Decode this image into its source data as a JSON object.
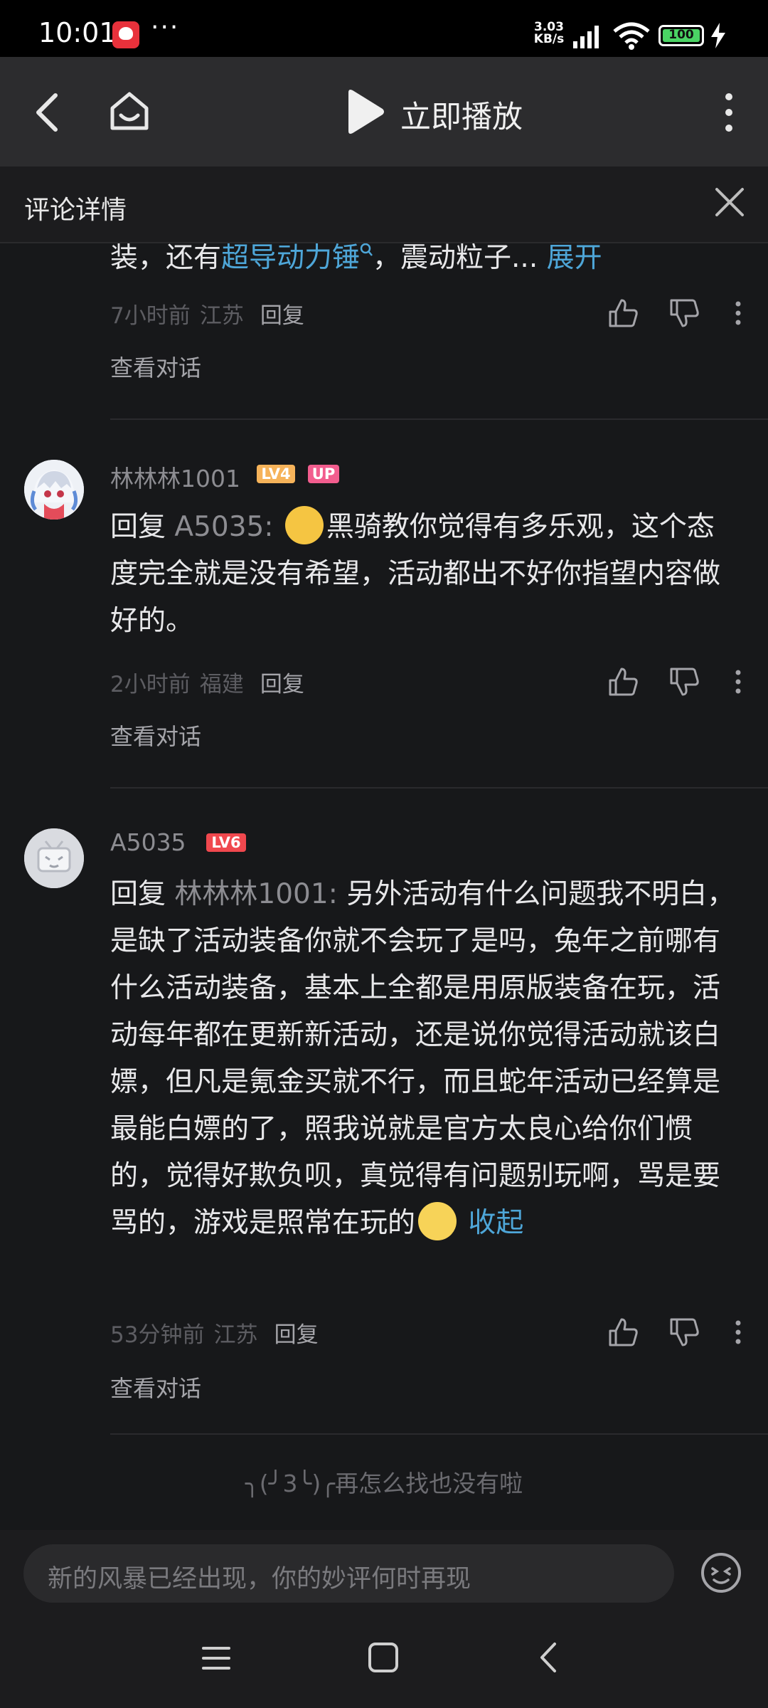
{
  "status_bar": {
    "time": "10:01",
    "dots": "···",
    "speed_value": "3.03",
    "speed_unit": "KB/s",
    "battery": "100"
  },
  "app_bar": {
    "title": "立即播放"
  },
  "panel": {
    "title": "评论详情"
  },
  "comments": [
    {
      "text_prefix": "装，还有",
      "link": "超导动力锤",
      "text_suffix": "，震动粒子...",
      "expand": "展开",
      "time": "7小时前",
      "location": "江苏",
      "reply": "回复",
      "view_conversation": "查看对话"
    },
    {
      "username": "林林林1001",
      "level": "LV4",
      "up_badge": "UP",
      "reply_prefix": "回复",
      "mention": "A5035",
      "colon": ":",
      "text": "黑骑教你觉得有多乐观，这个态度完全就是没有希望，活动都出不好你指望内容做好的。",
      "time": "2小时前",
      "location": "福建",
      "reply": "回复",
      "view_conversation": "查看对话"
    },
    {
      "username": "A5035",
      "level": "LV6",
      "reply_prefix": "回复",
      "mention": "林林林1001",
      "colon": ":",
      "text": "另外活动有什么问题我不明白，是缺了活动装备你就不会玩了是吗，兔年之前哪有什么活动装备，基本上全都是用原版装备在玩，活动每年都在更新新活动，还是说你觉得活动就该白嫖，但凡是氪金买就不行，而且蛇年活动已经算是最能白嫖的了，照我说就是官方太良心给你们惯的，觉得好欺负呗，真觉得有问题别玩啊，骂是要骂的，游戏是照常在玩的",
      "collapse": "收起",
      "time": "53分钟前",
      "location": "江苏",
      "reply": "回复",
      "view_conversation": "查看对话"
    }
  ],
  "end_note": "╮(╯3╰)╭再怎么找也没有啦",
  "input": {
    "placeholder": "新的风暴已经出现，你的妙评何时再现"
  }
}
